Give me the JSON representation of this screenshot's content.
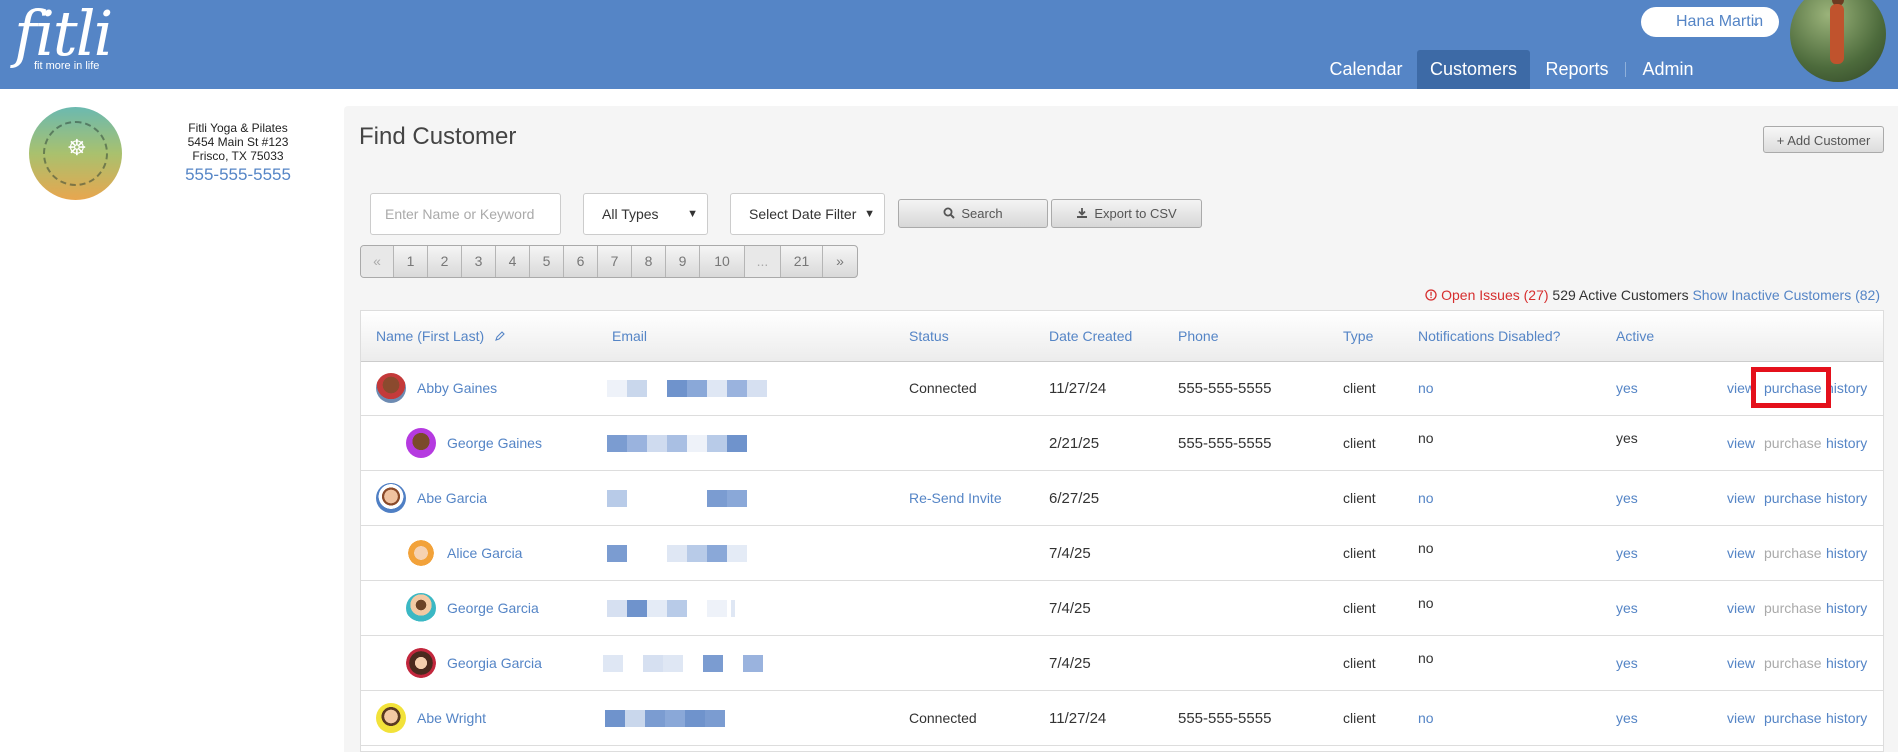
{
  "header": {
    "logo_word": "fitli",
    "logo_tagline": "fit more in life",
    "user_name": "Hana Martin",
    "user_chevron": "⌄",
    "nav": [
      {
        "label": "Calendar",
        "active": false
      },
      {
        "label": "Customers",
        "active": true
      },
      {
        "label": "Reports",
        "active": false
      },
      {
        "label": "Admin",
        "active": false
      }
    ]
  },
  "studio": {
    "name": "Fitli Yoga & Pilates",
    "address1": "5454 Main St #123",
    "address2": "Frisco, TX 75033",
    "phone": "555-555-5555"
  },
  "page": {
    "title": "Find Customer",
    "add_button": "+ Add Customer"
  },
  "filters": {
    "search_placeholder": "Enter Name or Keyword",
    "type_select": "All Types",
    "date_select": "Select Date Filter",
    "search_button": "Search",
    "export_button": "Export to CSV",
    "search_icon": "search-icon",
    "export_icon": "download-icon"
  },
  "pagination": [
    "«",
    "1",
    "2",
    "3",
    "4",
    "5",
    "6",
    "7",
    "8",
    "9",
    "10",
    "...",
    "21",
    "»"
  ],
  "summary": {
    "open_issues": "Open Issues (27)",
    "active_customers": "529 Active Customers",
    "show_inactive": "Show Inactive Customers (82)"
  },
  "table": {
    "columns": [
      "Name (First Last)",
      "Email",
      "Status",
      "Date Created",
      "Phone",
      "Type",
      "Notifications Disabled?",
      "Active"
    ],
    "rows": [
      {
        "name": "Abby Gaines",
        "status": "Connected",
        "date": "11/27/24",
        "phone": "555-555-5555",
        "type": "client",
        "notif": "no",
        "active": "yes",
        "view": "view",
        "purchase": "purchase",
        "history": "history"
      },
      {
        "name": "George Gaines",
        "status": "",
        "date": "2/21/25",
        "phone": "555-555-5555",
        "type": "client",
        "notif": "no",
        "active": "yes",
        "view": "view",
        "purchase": "purchase",
        "history": "history"
      },
      {
        "name": "Abe Garcia",
        "status": "Re-Send Invite",
        "date": "6/27/25",
        "phone": "",
        "type": "client",
        "notif": "no",
        "active": "yes",
        "view": "view",
        "purchase": "purchase",
        "history": "history"
      },
      {
        "name": "Alice Garcia",
        "status": "",
        "date": "7/4/25",
        "phone": "",
        "type": "client",
        "notif": "no",
        "active": "yes",
        "view": "view",
        "purchase": "purchase",
        "history": "history"
      },
      {
        "name": "George Garcia",
        "status": "",
        "date": "7/4/25",
        "phone": "",
        "type": "client",
        "notif": "no",
        "active": "yes",
        "view": "view",
        "purchase": "purchase",
        "history": "history"
      },
      {
        "name": "Georgia Garcia",
        "status": "",
        "date": "7/4/25",
        "phone": "",
        "type": "client",
        "notif": "no",
        "active": "yes",
        "view": "view",
        "purchase": "purchase",
        "history": "history"
      },
      {
        "name": "Abe Wright",
        "status": "Connected",
        "date": "11/27/24",
        "phone": "555-555-5555",
        "type": "client",
        "notif": "no",
        "active": "yes",
        "view": "view",
        "purchase": "purchase",
        "history": "history"
      }
    ]
  },
  "colors": {
    "brand_blue": "#5585c6",
    "highlight_red": "#e4101b",
    "issue_red": "#d62e2e"
  }
}
